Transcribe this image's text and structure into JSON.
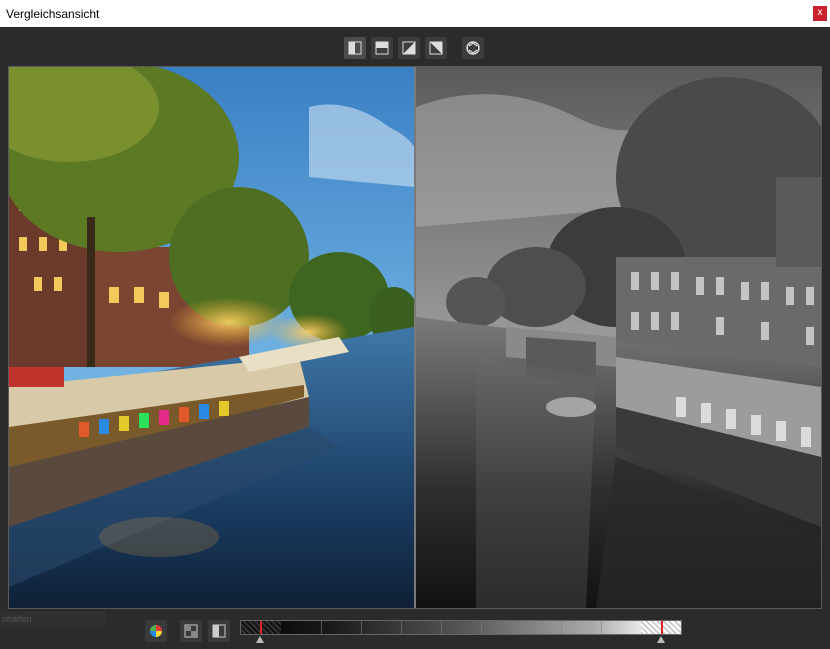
{
  "window": {
    "title": "Vergleichsansicht",
    "close_label": "x",
    "close_color": "#c8232c"
  },
  "toolbar": {
    "buttons": [
      {
        "name": "split-vertical-icon",
        "active": true
      },
      {
        "name": "split-horizontal-icon",
        "active": false
      },
      {
        "name": "split-diagonal-icon",
        "active": false
      },
      {
        "name": "split-diagonal-reverse-icon",
        "active": false
      },
      {
        "name": "swap-compare-icon",
        "active": false
      }
    ]
  },
  "compare": {
    "left": "color-image",
    "right": "black-white-image"
  },
  "status": {
    "fragment": "nhalten"
  },
  "bottom": {
    "buttons": [
      {
        "name": "color-picker-icon"
      },
      {
        "name": "clipping-view-icon"
      },
      {
        "name": "split-compare-icon"
      }
    ]
  }
}
